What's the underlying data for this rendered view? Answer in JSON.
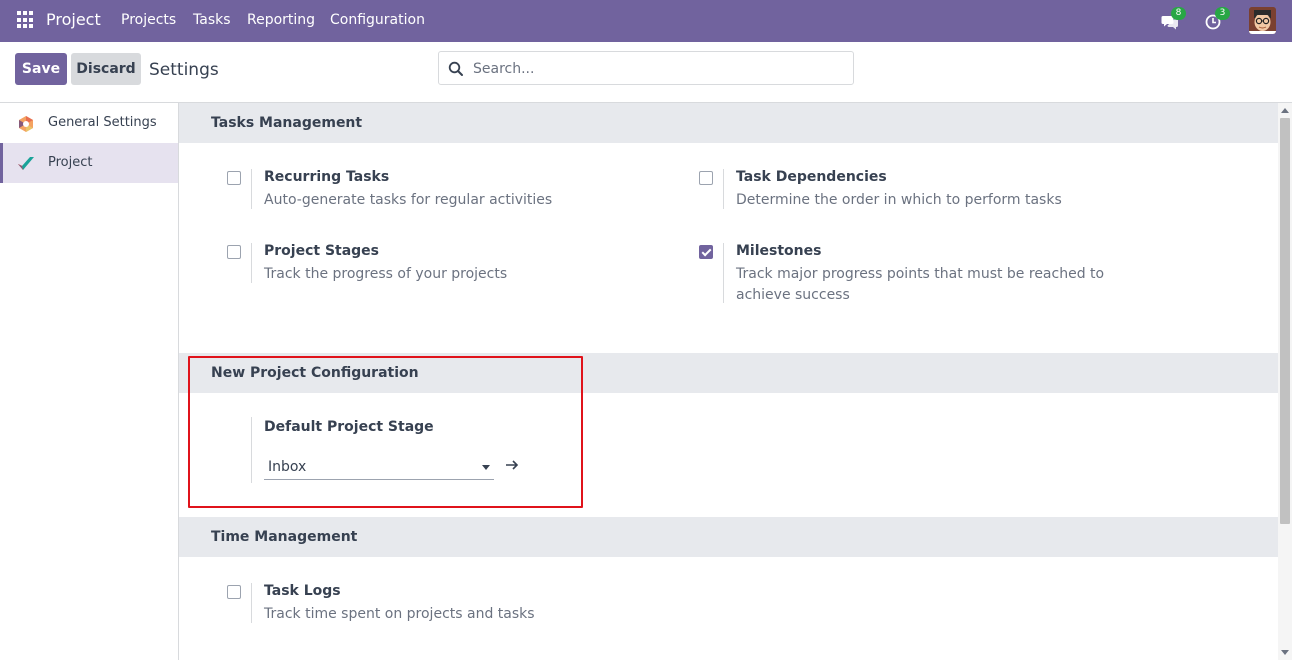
{
  "navbar": {
    "app_name": "Project",
    "menu": [
      "Projects",
      "Tasks",
      "Reporting",
      "Configuration"
    ],
    "messages_count": "8",
    "activities_count": "3",
    "accent_color": "#71639e"
  },
  "control_panel": {
    "save_label": "Save",
    "discard_label": "Discard",
    "breadcrumb": "Settings",
    "search_placeholder": "Search..."
  },
  "sidebar": {
    "items": [
      {
        "label": "General Settings",
        "icon": "odoo-logo-icon"
      },
      {
        "label": "Project",
        "icon": "project-app-icon",
        "active": true
      }
    ]
  },
  "sections": {
    "tasks_management": {
      "title": "Tasks Management",
      "settings": [
        {
          "title": "Recurring Tasks",
          "desc": "Auto-generate tasks for regular activities",
          "checked": false
        },
        {
          "title": "Task Dependencies",
          "desc": "Determine the order in which to perform tasks",
          "checked": false
        },
        {
          "title": "Project Stages",
          "desc": "Track the progress of your projects",
          "checked": false
        },
        {
          "title": "Milestones",
          "desc": "Track major progress points that must be reached to achieve success",
          "checked": true
        }
      ]
    },
    "new_project": {
      "title": "New Project Configuration",
      "field_label": "Default Project Stage",
      "field_value": "Inbox"
    },
    "time_management": {
      "title": "Time Management",
      "settings": [
        {
          "title": "Task Logs",
          "desc": "Track time spent on projects and tasks",
          "checked": false
        }
      ]
    }
  },
  "highlight_color": "#e0131b"
}
